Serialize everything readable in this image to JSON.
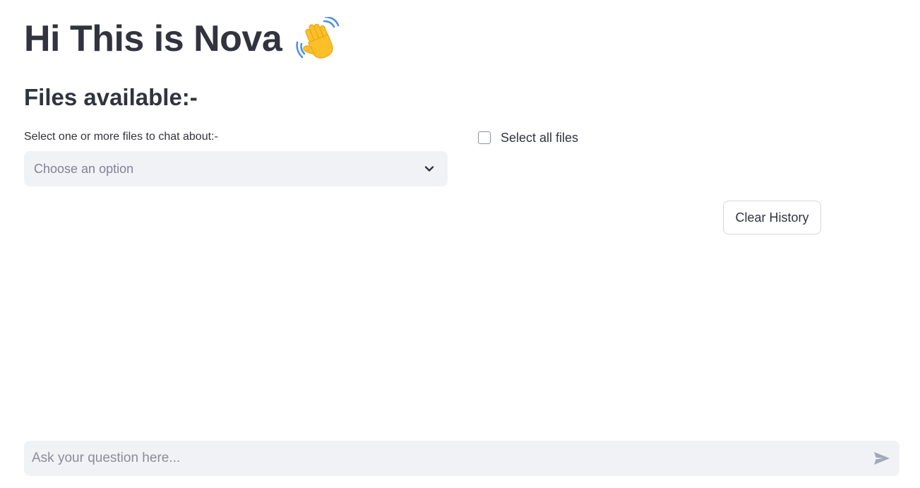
{
  "header": {
    "title": "Hi This is Nova",
    "title_icon": "waving-hand-icon"
  },
  "files_section": {
    "heading": "Files available:-",
    "select_label": "Select one or more files to chat about:-",
    "select_placeholder": "Choose an option",
    "select_icon": "chevron-down-icon",
    "select_all_label": "Select all files",
    "select_all_checked": false
  },
  "actions": {
    "clear_history_label": "Clear History"
  },
  "chat": {
    "input_placeholder": "Ask your question here...",
    "input_value": "",
    "send_icon": "send-icon"
  },
  "colors": {
    "text": "#31333f",
    "input_background": "#f0f2f6",
    "placeholder": "#808495",
    "wave_hand": "#fbbf2a",
    "wave_lines": "#4a8cf0"
  }
}
